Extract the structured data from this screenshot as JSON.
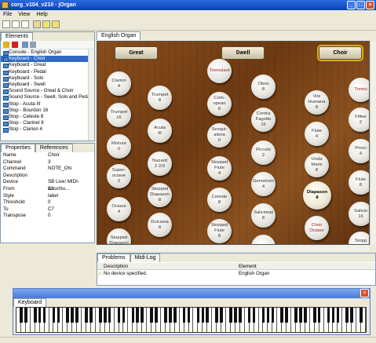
{
  "window": {
    "title": "corg_v104_v210 - jOrgan"
  },
  "menu": [
    "File",
    "View",
    "Help"
  ],
  "elements": {
    "tab_label": "Elements",
    "items": [
      "Console - English Organ",
      "Keyboard - Choir",
      "Keyboard - Great",
      "Keyboard - Pedal",
      "Keyboard - Solo",
      "Keyboard - Swell",
      "Sound Source - Great & Choir",
      "Sound Source - Swell, Solo and Pedal",
      "Stop - Acuta  III",
      "Stop - Bourdon  16",
      "Stop - Celeste  8",
      "Stop - Clarinet  8",
      "Stop - Clarion  4"
    ],
    "selected_index": 1
  },
  "properties": {
    "tabs": [
      "Properties",
      "References"
    ],
    "rows": [
      {
        "k": "Name",
        "v": "Choir"
      },
      {
        "k": "Channel",
        "v": "3"
      },
      {
        "k": "Command",
        "v": "NOTE_ON"
      },
      {
        "k": "Description",
        "v": ""
      },
      {
        "k": "Device",
        "v": "SB Live! MIDI-Anschlu..."
      },
      {
        "k": "From",
        "v": "C1"
      },
      {
        "k": "Style",
        "v": "label"
      },
      {
        "k": "Threshold",
        "v": "0"
      },
      {
        "k": "To",
        "v": "C7"
      },
      {
        "k": "Transpose",
        "v": "0"
      }
    ]
  },
  "organ": {
    "tab_label": "English Organ",
    "divisions": [
      "Great",
      "Swell",
      "Choir"
    ],
    "stops": [
      {
        "t": "Clarion\n4",
        "red": false
      },
      {
        "t": "Trumpet\n16",
        "red": false
      },
      {
        "t": "Mixture\nII",
        "red": false
      },
      {
        "t": "Super-\noctave\n2",
        "red": false
      },
      {
        "t": "Octave\n4",
        "red": false
      },
      {
        "t": "Stopped\nDiapason",
        "red": false
      },
      {
        "t": "Trumpet\n8",
        "red": false
      },
      {
        "t": "Acuta\nIII",
        "red": false
      },
      {
        "t": "Nazard\n2 2/3",
        "red": false
      },
      {
        "t": "Stopped\nDiapason\n8",
        "red": false
      },
      {
        "t": "Dulciana\n8",
        "red": false
      },
      {
        "t": "Tremulant",
        "red": true
      },
      {
        "t": "Com-\nopean\n8",
        "red": false
      },
      {
        "t": "Sesqui-\naltera\nII",
        "red": false
      },
      {
        "t": "Stopped\nFlute\n4",
        "red": false
      },
      {
        "t": "Celeste\n8",
        "red": false
      },
      {
        "t": "Stopped\nFlute\n8",
        "red": false
      },
      {
        "t": "Oboe\n8",
        "red": false
      },
      {
        "t": "Contra\nFagotto\n16",
        "red": false
      },
      {
        "t": "Piccolo\n2",
        "red": false
      },
      {
        "t": "Gemshorn\n4",
        "red": false
      },
      {
        "t": "Salicional\n8",
        "red": false
      },
      {
        "t": "Bourdon",
        "red": false
      },
      {
        "t": "Vox\nHumana\n8",
        "red": false
      },
      {
        "t": "Flute\n4",
        "red": false
      },
      {
        "t": "Unda\nMaris\n8",
        "red": false
      },
      {
        "t": "Diapason\n8",
        "red": false,
        "on": true
      },
      {
        "t": "Choir\nOctave",
        "red": true
      },
      {
        "t": "Tremu",
        "red": true
      },
      {
        "t": "Fiftee\n2",
        "red": false
      },
      {
        "t": "Princi\n4",
        "red": false
      },
      {
        "t": "Flute\n8",
        "red": false
      },
      {
        "t": "Salicio\n16",
        "red": false
      },
      {
        "t": "Stopp\nFlute",
        "red": false
      }
    ]
  },
  "problems": {
    "tabs": [
      "Problems",
      "Midi-Log"
    ],
    "headers": [
      "Description",
      "Element"
    ],
    "rows": [
      {
        "description": "No device specified.",
        "element": "English Organ"
      }
    ]
  },
  "keyboard": {
    "tab_label": "Keyboard"
  }
}
